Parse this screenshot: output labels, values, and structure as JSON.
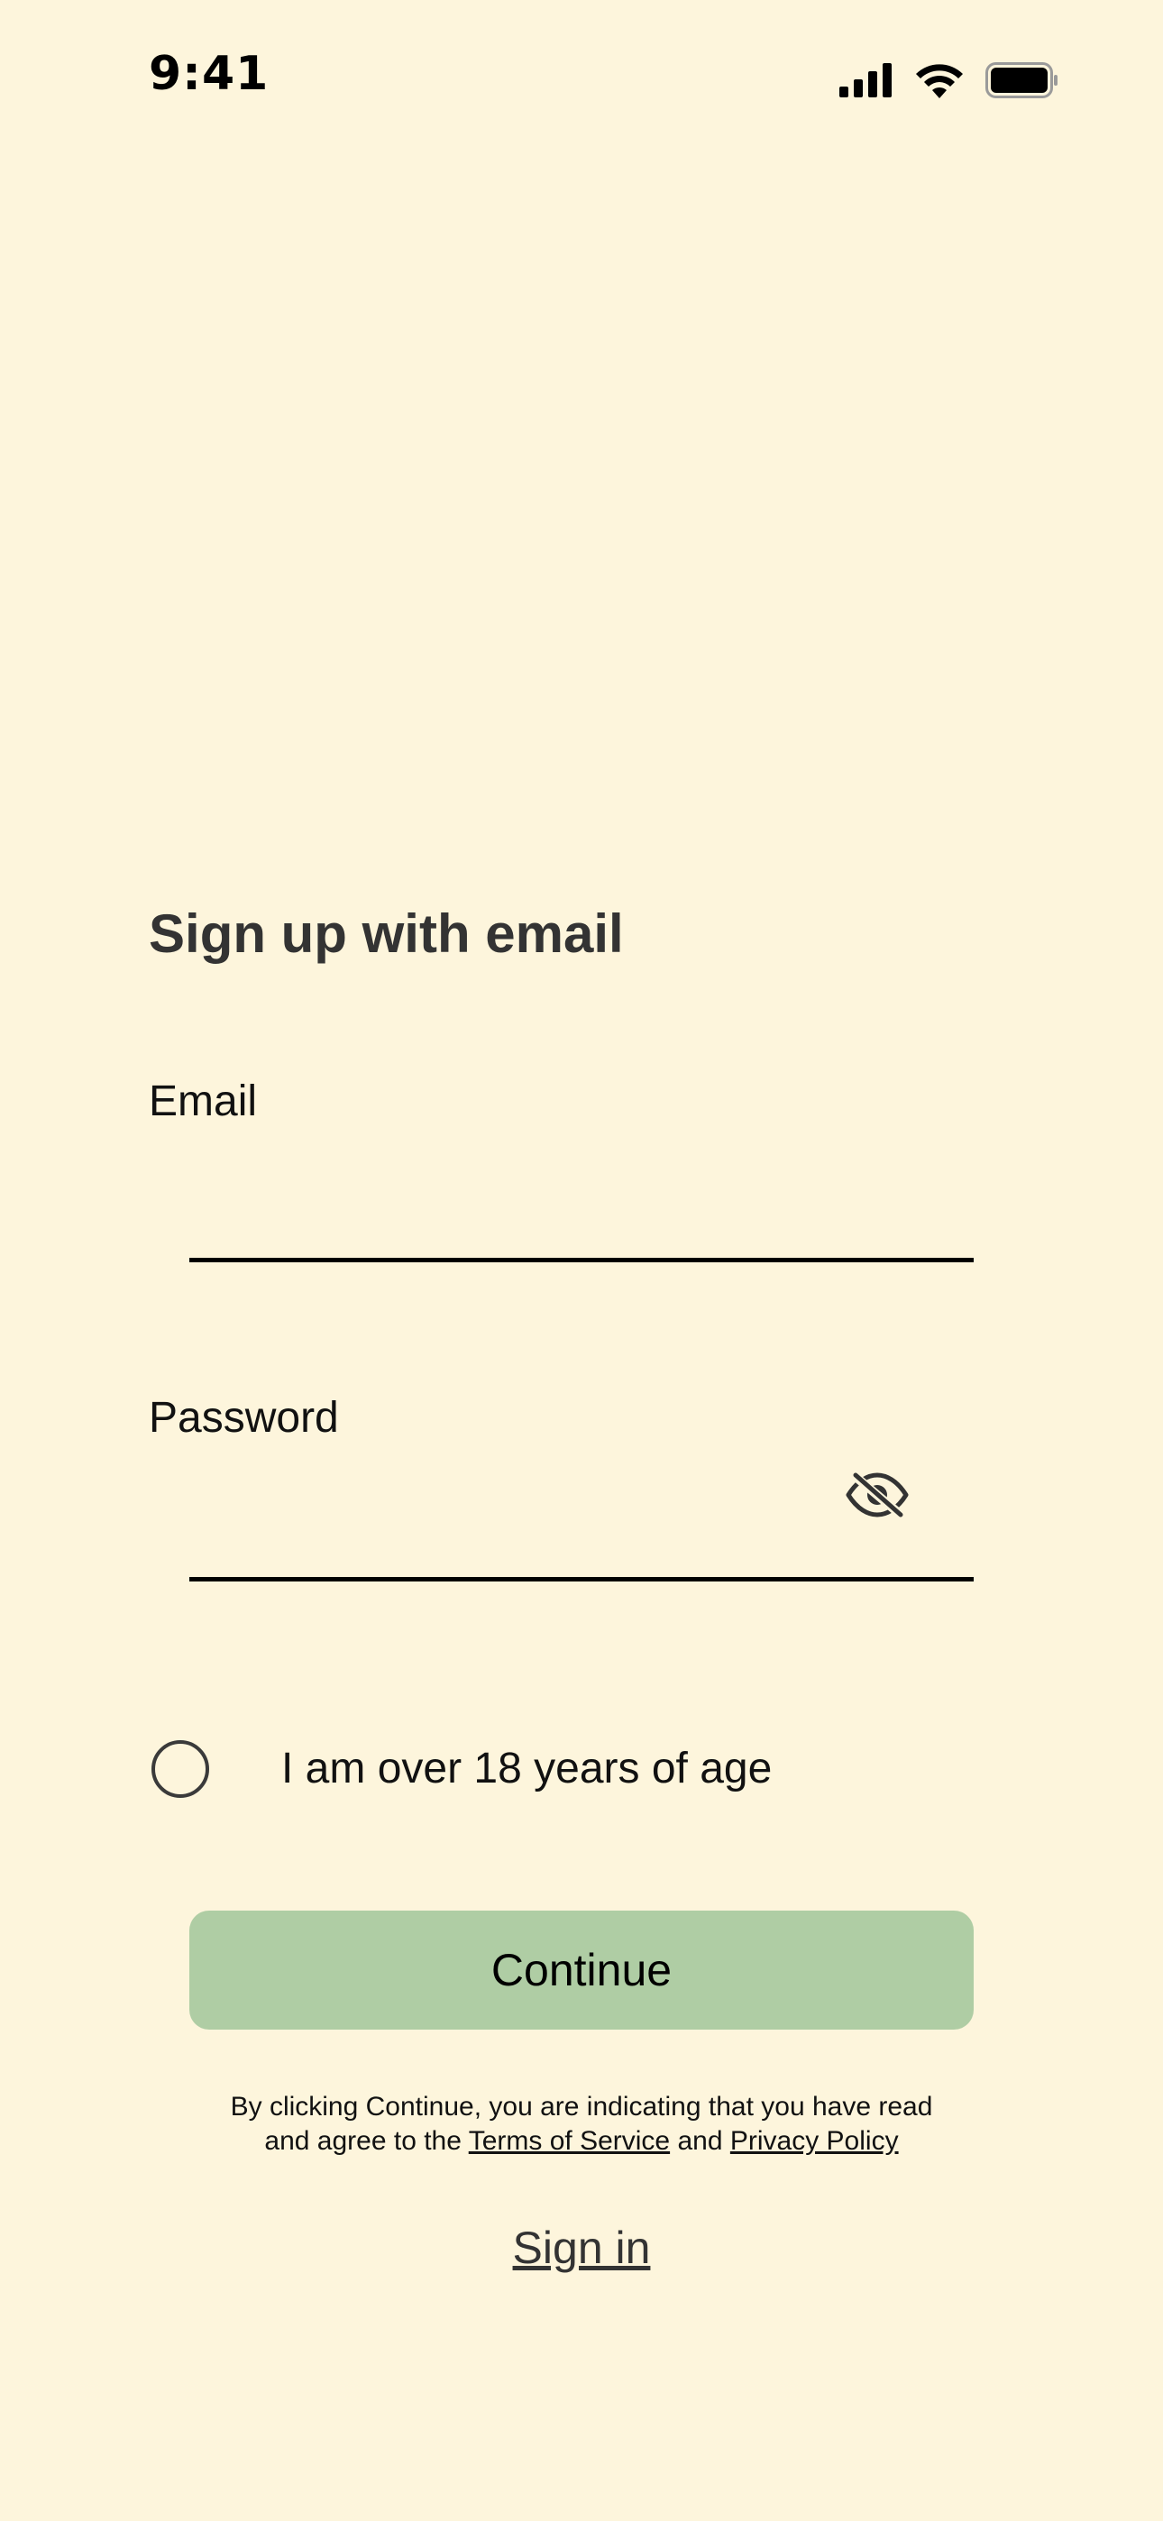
{
  "status_bar": {
    "time": "9:41",
    "icons": [
      "cellular-signal-icon",
      "wifi-icon",
      "battery-icon"
    ]
  },
  "form": {
    "title": "Sign up with email",
    "email": {
      "label": "Email",
      "value": "",
      "placeholder": ""
    },
    "password": {
      "label": "Password",
      "value": "",
      "placeholder": "",
      "visibility_icon": "eye-off-icon"
    },
    "age_checkbox": {
      "label": "I am over 18 years of age",
      "checked": false
    },
    "continue_label": "Continue",
    "terms": {
      "prefix_line1": "By clicking Continue, you are indicating that you have read",
      "prefix_line2": "and agree to the",
      "tos_link": "Terms of Service",
      "conjunction": "and",
      "privacy_link": "Privacy Policy"
    },
    "signin_label": "Sign in"
  },
  "colors": {
    "background": "#fdf5dc",
    "button": "#afcda4",
    "title": "#333333"
  }
}
